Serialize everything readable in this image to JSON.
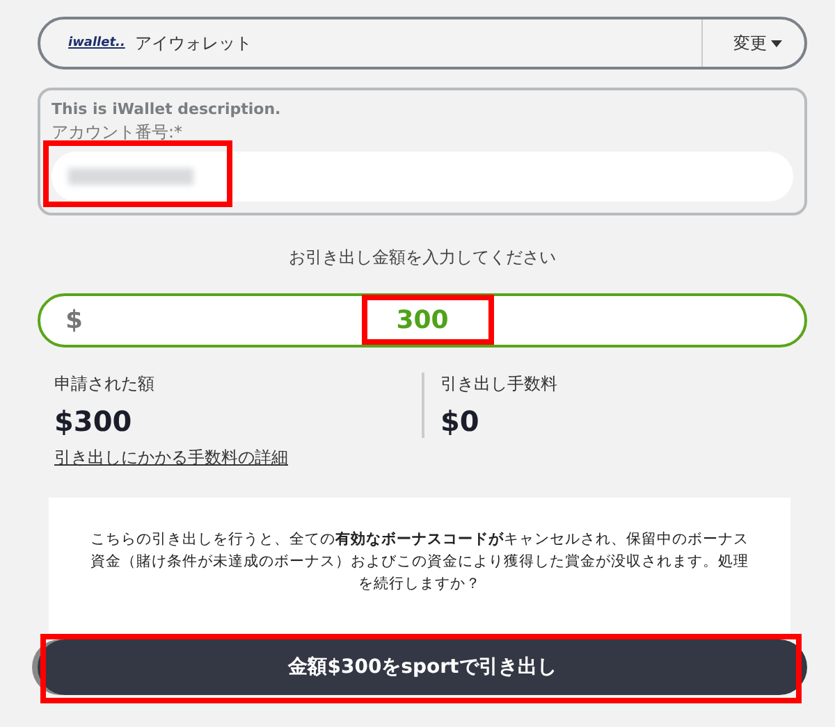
{
  "payment_method": {
    "logo": "iwallet..",
    "name": "アイウォレット",
    "change_button": "変更"
  },
  "account_panel": {
    "description": "This is iWallet description.",
    "label": "アカウント番号:*",
    "value_redacted": true,
    "highlighted": true
  },
  "amount": {
    "prompt": "お引き出し金額を入力してください",
    "currency": "$",
    "value": "300",
    "highlighted": true
  },
  "summary": [
    {
      "label": "申請された額",
      "value": "$300"
    },
    {
      "label": "引き出し手数料",
      "value": "$0"
    }
  ],
  "fee_link": "引き出しにかかる手数料の詳細",
  "notice": "こちらの引き出しを行うと、全ての**有効なボーナスコードが**キャンセルされ、保留中のボーナス資金（賭け条件が未達成のボーナス）およびこの資金により獲得した賞金が没収されます。処理を続行しますか？",
  "withdraw_button": {
    "label": "金額$300をsportで引き出し",
    "highlighted": true
  }
}
